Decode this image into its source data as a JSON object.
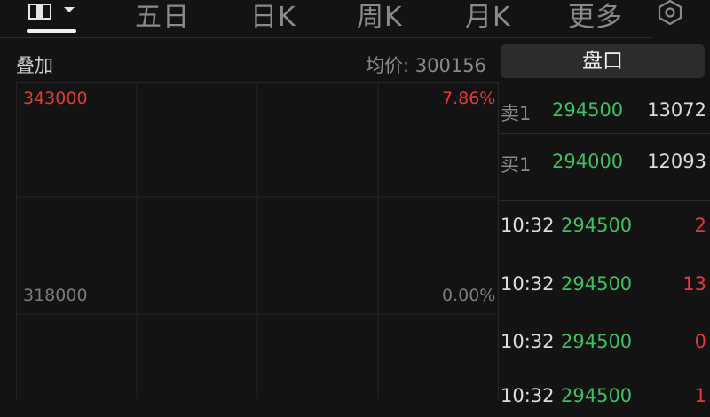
{
  "tabs": {
    "five_day": "五日",
    "day_k": "日K",
    "week_k": "周K",
    "month_k": "月K",
    "more": "更多"
  },
  "info": {
    "overlay": "叠加",
    "avg_price_label": "均价: 300156"
  },
  "chart": {
    "y_high": "343000",
    "y_mid": "318000",
    "pct_high": "7.86%",
    "pct_mid": "0.00%"
  },
  "panel": {
    "button_label": "盘口",
    "ask": {
      "side": "卖1",
      "price": "294500",
      "qty": "13072"
    },
    "bid": {
      "side": "买1",
      "price": "294000",
      "qty": "12093"
    },
    "trades": [
      {
        "time": "10:32",
        "price": "294500",
        "vol": "2"
      },
      {
        "time": "10:32",
        "price": "294500",
        "vol": "13"
      },
      {
        "time": "10:32",
        "price": "294500",
        "vol": "0"
      },
      {
        "time": "10:32",
        "price": "294500",
        "vol": "1"
      }
    ]
  },
  "colors": {
    "background": "#131313",
    "up_red": "#e23b3b",
    "down_green": "#3fbf62",
    "panel_button": "#2c2c2c"
  }
}
